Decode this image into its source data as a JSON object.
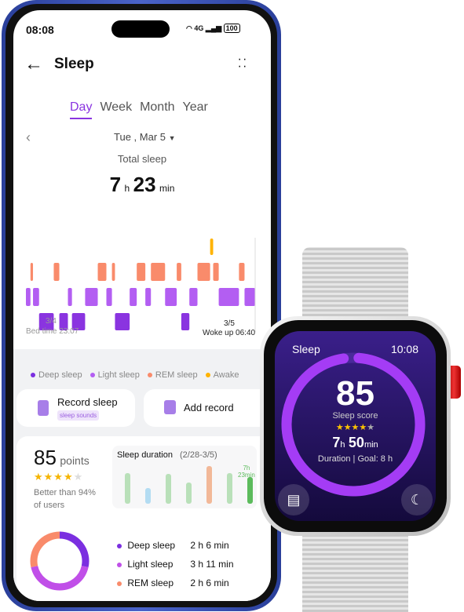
{
  "status": {
    "time": "08:08",
    "network": "4G",
    "battery": "100"
  },
  "header": {
    "title": "Sleep"
  },
  "tabs": [
    {
      "label": "Day",
      "active": true
    },
    {
      "label": "Week"
    },
    {
      "label": "Month"
    },
    {
      "label": "Year"
    }
  ],
  "date": "Tue , Mar 5",
  "total": {
    "label": "Total sleep",
    "hours": "7",
    "h": "h",
    "minutes": "23",
    "min": "min"
  },
  "chart_data": {
    "type": "timeline",
    "start": "23:07",
    "end": "06:40",
    "stages": [
      [
        "light",
        9
      ],
      [
        "rem",
        5
      ],
      [
        "light",
        12
      ],
      [
        "deep",
        29
      ],
      [
        "rem",
        11
      ],
      [
        "deep",
        17
      ],
      [
        "light",
        8
      ],
      [
        "deep",
        26
      ],
      [
        "light",
        25
      ],
      [
        "rem",
        17
      ],
      [
        "light",
        11
      ],
      [
        "rem",
        6
      ],
      [
        "deep",
        29
      ],
      [
        "light",
        14
      ],
      [
        "rem",
        17
      ],
      [
        "light",
        11
      ],
      [
        "rem",
        28
      ],
      [
        "light",
        23
      ],
      [
        "rem",
        9
      ],
      [
        "deep",
        16
      ],
      [
        "light",
        16
      ],
      [
        "rem",
        25
      ],
      [
        "awake",
        6
      ],
      [
        "rem",
        11
      ],
      [
        "light",
        40
      ],
      [
        "rem",
        11
      ],
      [
        "light",
        21
      ]
    ],
    "colors": {
      "deep": "#8a34e0",
      "light": "#b35ef2",
      "rem": "#f98b6b",
      "awake": "#ffb300"
    }
  },
  "bed": {
    "date": "3/4",
    "label": "Bed time 23:07"
  },
  "wake": {
    "date": "3/5",
    "label": "Woke up 06:40"
  },
  "legend": [
    {
      "label": "Deep sleep",
      "color": "#7b2fe0"
    },
    {
      "label": "Light sleep",
      "color": "#b35ef2"
    },
    {
      "label": "REM sleep",
      "color": "#f98b6b"
    },
    {
      "label": "Awake",
      "color": "#ffb300"
    }
  ],
  "actions": {
    "record": "Record sleep",
    "record_sub": "sleep sounds",
    "add": "Add record"
  },
  "score": {
    "value": "85",
    "unit": "points",
    "stars": 4,
    "better": "Better than 94%",
    "of_users": "of users"
  },
  "duration": {
    "title": "Sleep duration",
    "range": "(2/28-3/5)",
    "last_label_h": "7h",
    "last_label_m": "23min",
    "values": [
      8.5,
      4.5,
      8.3,
      6,
      10.5,
      8.5,
      7.38
    ],
    "colors": [
      "#b9e0b9",
      "#b3dcf2",
      "#b9e0b9",
      "#b9e0b9",
      "#f2b898",
      "#b9e0b9",
      "#5cbb5c"
    ]
  },
  "breakdown": [
    {
      "label": "Deep sleep",
      "value": "2 h 6 min",
      "minutes": 126,
      "color": "#7b2fe0"
    },
    {
      "label": "Light sleep",
      "value": "3 h 11 min",
      "minutes": 191,
      "color": "#c04fe8"
    },
    {
      "label": "REM sleep",
      "value": "2 h 6 min",
      "minutes": 126,
      "color": "#f98b6b"
    }
  ],
  "watch": {
    "title": "Sleep",
    "time": "10:08",
    "score": "85",
    "score_label": "Sleep score",
    "stars": 4.5,
    "hours": "7",
    "h": "h",
    "minutes": "50",
    "min": "min",
    "goal": "Duration | Goal: 8 h",
    "progress": 0.98
  }
}
